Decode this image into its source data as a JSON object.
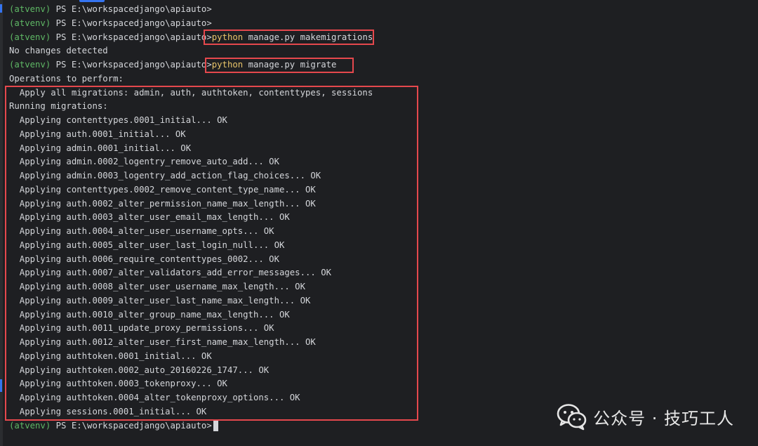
{
  "terminal": {
    "env": "(atvenv)",
    "prompt": " PS E:\\workspacedjango\\apiauto>",
    "lines": [
      {
        "kind": "prompt",
        "cmd": "",
        "args": ""
      },
      {
        "kind": "prompt",
        "cmd": "",
        "args": ""
      },
      {
        "kind": "prompt",
        "cmd": "python",
        "args": " manage.py makemigrations"
      },
      {
        "kind": "output",
        "text": "No changes detected"
      },
      {
        "kind": "prompt",
        "cmd": "python",
        "args": " manage.py migrate"
      },
      {
        "kind": "output",
        "text": "Operations to perform:"
      },
      {
        "kind": "output",
        "text": "  Apply all migrations: admin, auth, authtoken, contenttypes, sessions"
      },
      {
        "kind": "output",
        "text": "Running migrations:"
      },
      {
        "kind": "output",
        "text": "  Applying contenttypes.0001_initial... OK"
      },
      {
        "kind": "output",
        "text": "  Applying auth.0001_initial... OK"
      },
      {
        "kind": "output",
        "text": "  Applying admin.0001_initial... OK"
      },
      {
        "kind": "output",
        "text": "  Applying admin.0002_logentry_remove_auto_add... OK"
      },
      {
        "kind": "output",
        "text": "  Applying admin.0003_logentry_add_action_flag_choices... OK"
      },
      {
        "kind": "output",
        "text": "  Applying contenttypes.0002_remove_content_type_name... OK"
      },
      {
        "kind": "output",
        "text": "  Applying auth.0002_alter_permission_name_max_length... OK"
      },
      {
        "kind": "output",
        "text": "  Applying auth.0003_alter_user_email_max_length... OK"
      },
      {
        "kind": "output",
        "text": "  Applying auth.0004_alter_user_username_opts... OK"
      },
      {
        "kind": "output",
        "text": "  Applying auth.0005_alter_user_last_login_null... OK"
      },
      {
        "kind": "output",
        "text": "  Applying auth.0006_require_contenttypes_0002... OK"
      },
      {
        "kind": "output",
        "text": "  Applying auth.0007_alter_validators_add_error_messages... OK"
      },
      {
        "kind": "output",
        "text": "  Applying auth.0008_alter_user_username_max_length... OK"
      },
      {
        "kind": "output",
        "text": "  Applying auth.0009_alter_user_last_name_max_length... OK"
      },
      {
        "kind": "output",
        "text": "  Applying auth.0010_alter_group_name_max_length... OK"
      },
      {
        "kind": "output",
        "text": "  Applying auth.0011_update_proxy_permissions... OK"
      },
      {
        "kind": "output",
        "text": "  Applying auth.0012_alter_user_first_name_max_length... OK"
      },
      {
        "kind": "output",
        "text": "  Applying authtoken.0001_initial... OK"
      },
      {
        "kind": "output",
        "text": "  Applying authtoken.0002_auto_20160226_1747... OK"
      },
      {
        "kind": "output",
        "text": "  Applying authtoken.0003_tokenproxy... OK"
      },
      {
        "kind": "output",
        "text": "  Applying authtoken.0004_alter_tokenproxy_options... OK"
      },
      {
        "kind": "output",
        "text": "  Applying sessions.0001_initial... OK"
      },
      {
        "kind": "prompt-active",
        "cmd": "",
        "args": ""
      }
    ]
  },
  "watermark": {
    "icon": "wechat-icon",
    "text": "公众号 · 技巧工人"
  },
  "colors": {
    "background": "#1e1f22",
    "env": "#5fb865",
    "command": "#e8c46a",
    "highlight": "#e5484d",
    "text": "#d4d6da"
  }
}
